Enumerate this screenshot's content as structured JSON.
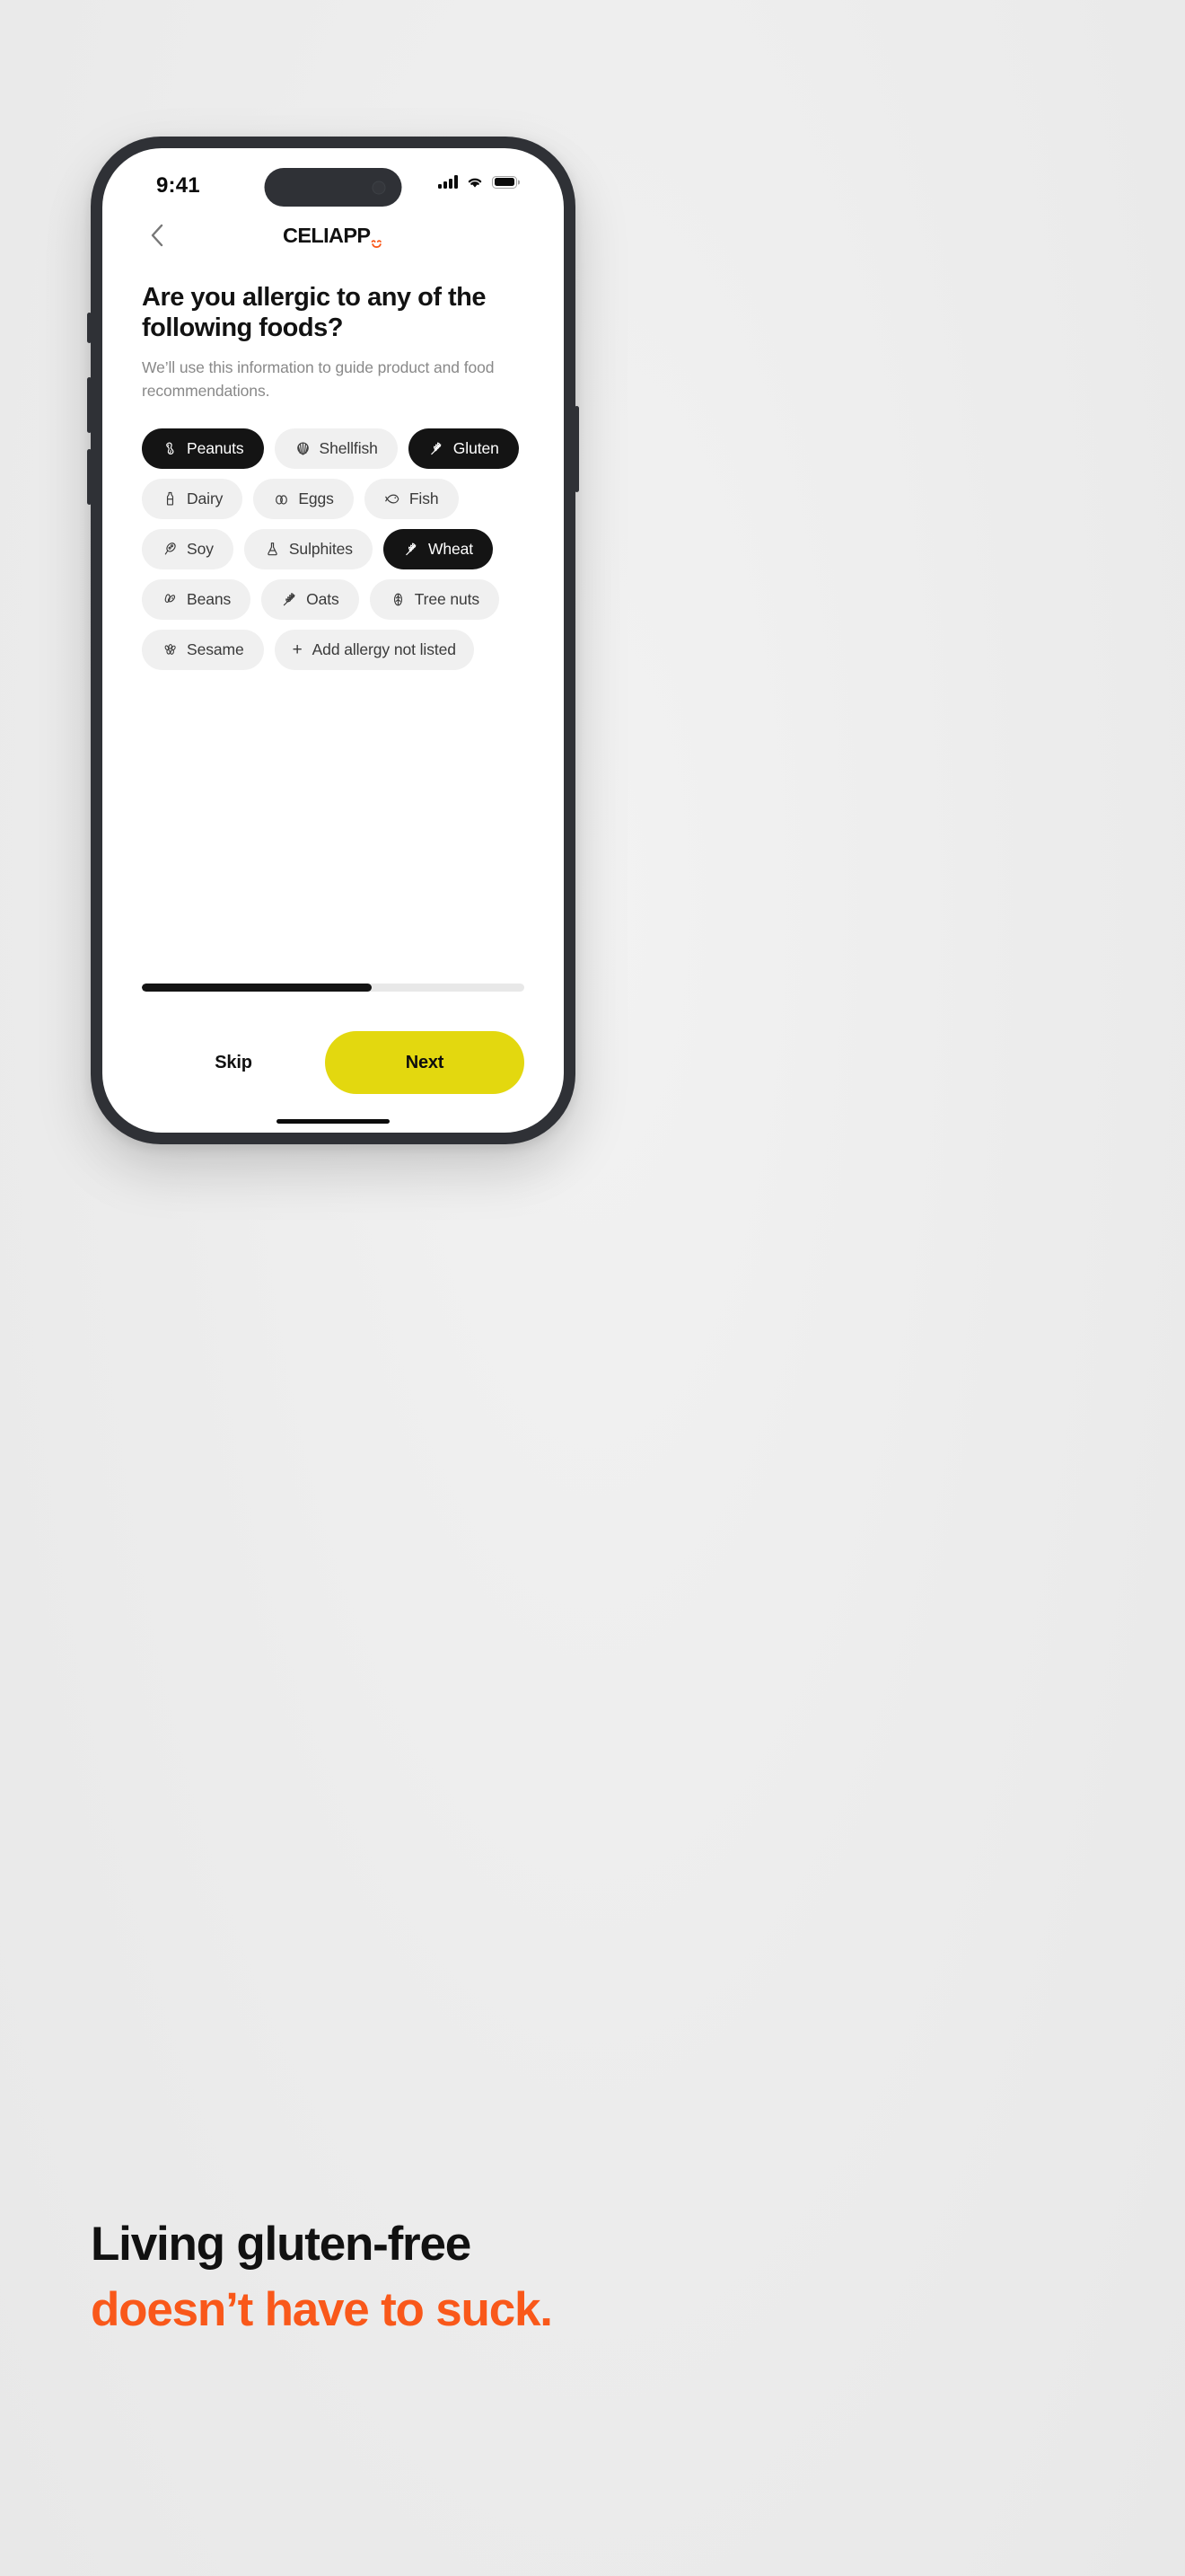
{
  "statusbar": {
    "time": "9:41",
    "signal_icon": "cellular-bars-icon",
    "wifi_icon": "wifi-icon",
    "battery_icon": "battery-full-icon"
  },
  "navbar": {
    "back_icon": "chevron-left-icon",
    "logo_text": "CELIAPP",
    "logo_mark": "smile-icon",
    "logo_mark_color": "#f9581a"
  },
  "main": {
    "headline": "Are you allergic to any of the following foods?",
    "subtext": "We’ll use this information to guide product and food recommendations.",
    "chips": [
      {
        "label": "Peanuts",
        "icon": "peanut-icon",
        "selected": true
      },
      {
        "label": "Shellfish",
        "icon": "shell-icon",
        "selected": false
      },
      {
        "label": "Gluten",
        "icon": "wheat-icon",
        "selected": true
      },
      {
        "label": "Dairy",
        "icon": "milk-bottle-icon",
        "selected": false
      },
      {
        "label": "Eggs",
        "icon": "eggs-icon",
        "selected": false
      },
      {
        "label": "Fish",
        "icon": "fish-icon",
        "selected": false
      },
      {
        "label": "Soy",
        "icon": "soy-pod-icon",
        "selected": false
      },
      {
        "label": "Sulphites",
        "icon": "flask-icon",
        "selected": false
      },
      {
        "label": "Wheat",
        "icon": "wheat-icon",
        "selected": true
      },
      {
        "label": "Beans",
        "icon": "beans-icon",
        "selected": false
      },
      {
        "label": "Oats",
        "icon": "oats-icon",
        "selected": false
      },
      {
        "label": "Tree nuts",
        "icon": "treenut-icon",
        "selected": false
      },
      {
        "label": "Sesame",
        "icon": "sesame-icon",
        "selected": false
      }
    ],
    "add_chip": {
      "plus": "+",
      "label": "Add allergy not listed"
    }
  },
  "bottom": {
    "progress_percent": 60,
    "skip_label": "Skip",
    "next_label": "Next",
    "next_color": "#e3d80f"
  },
  "tagline": {
    "line1": "Living gluten-free",
    "line2": "doesn’t have to suck.",
    "line2_color": "#f9581a"
  }
}
